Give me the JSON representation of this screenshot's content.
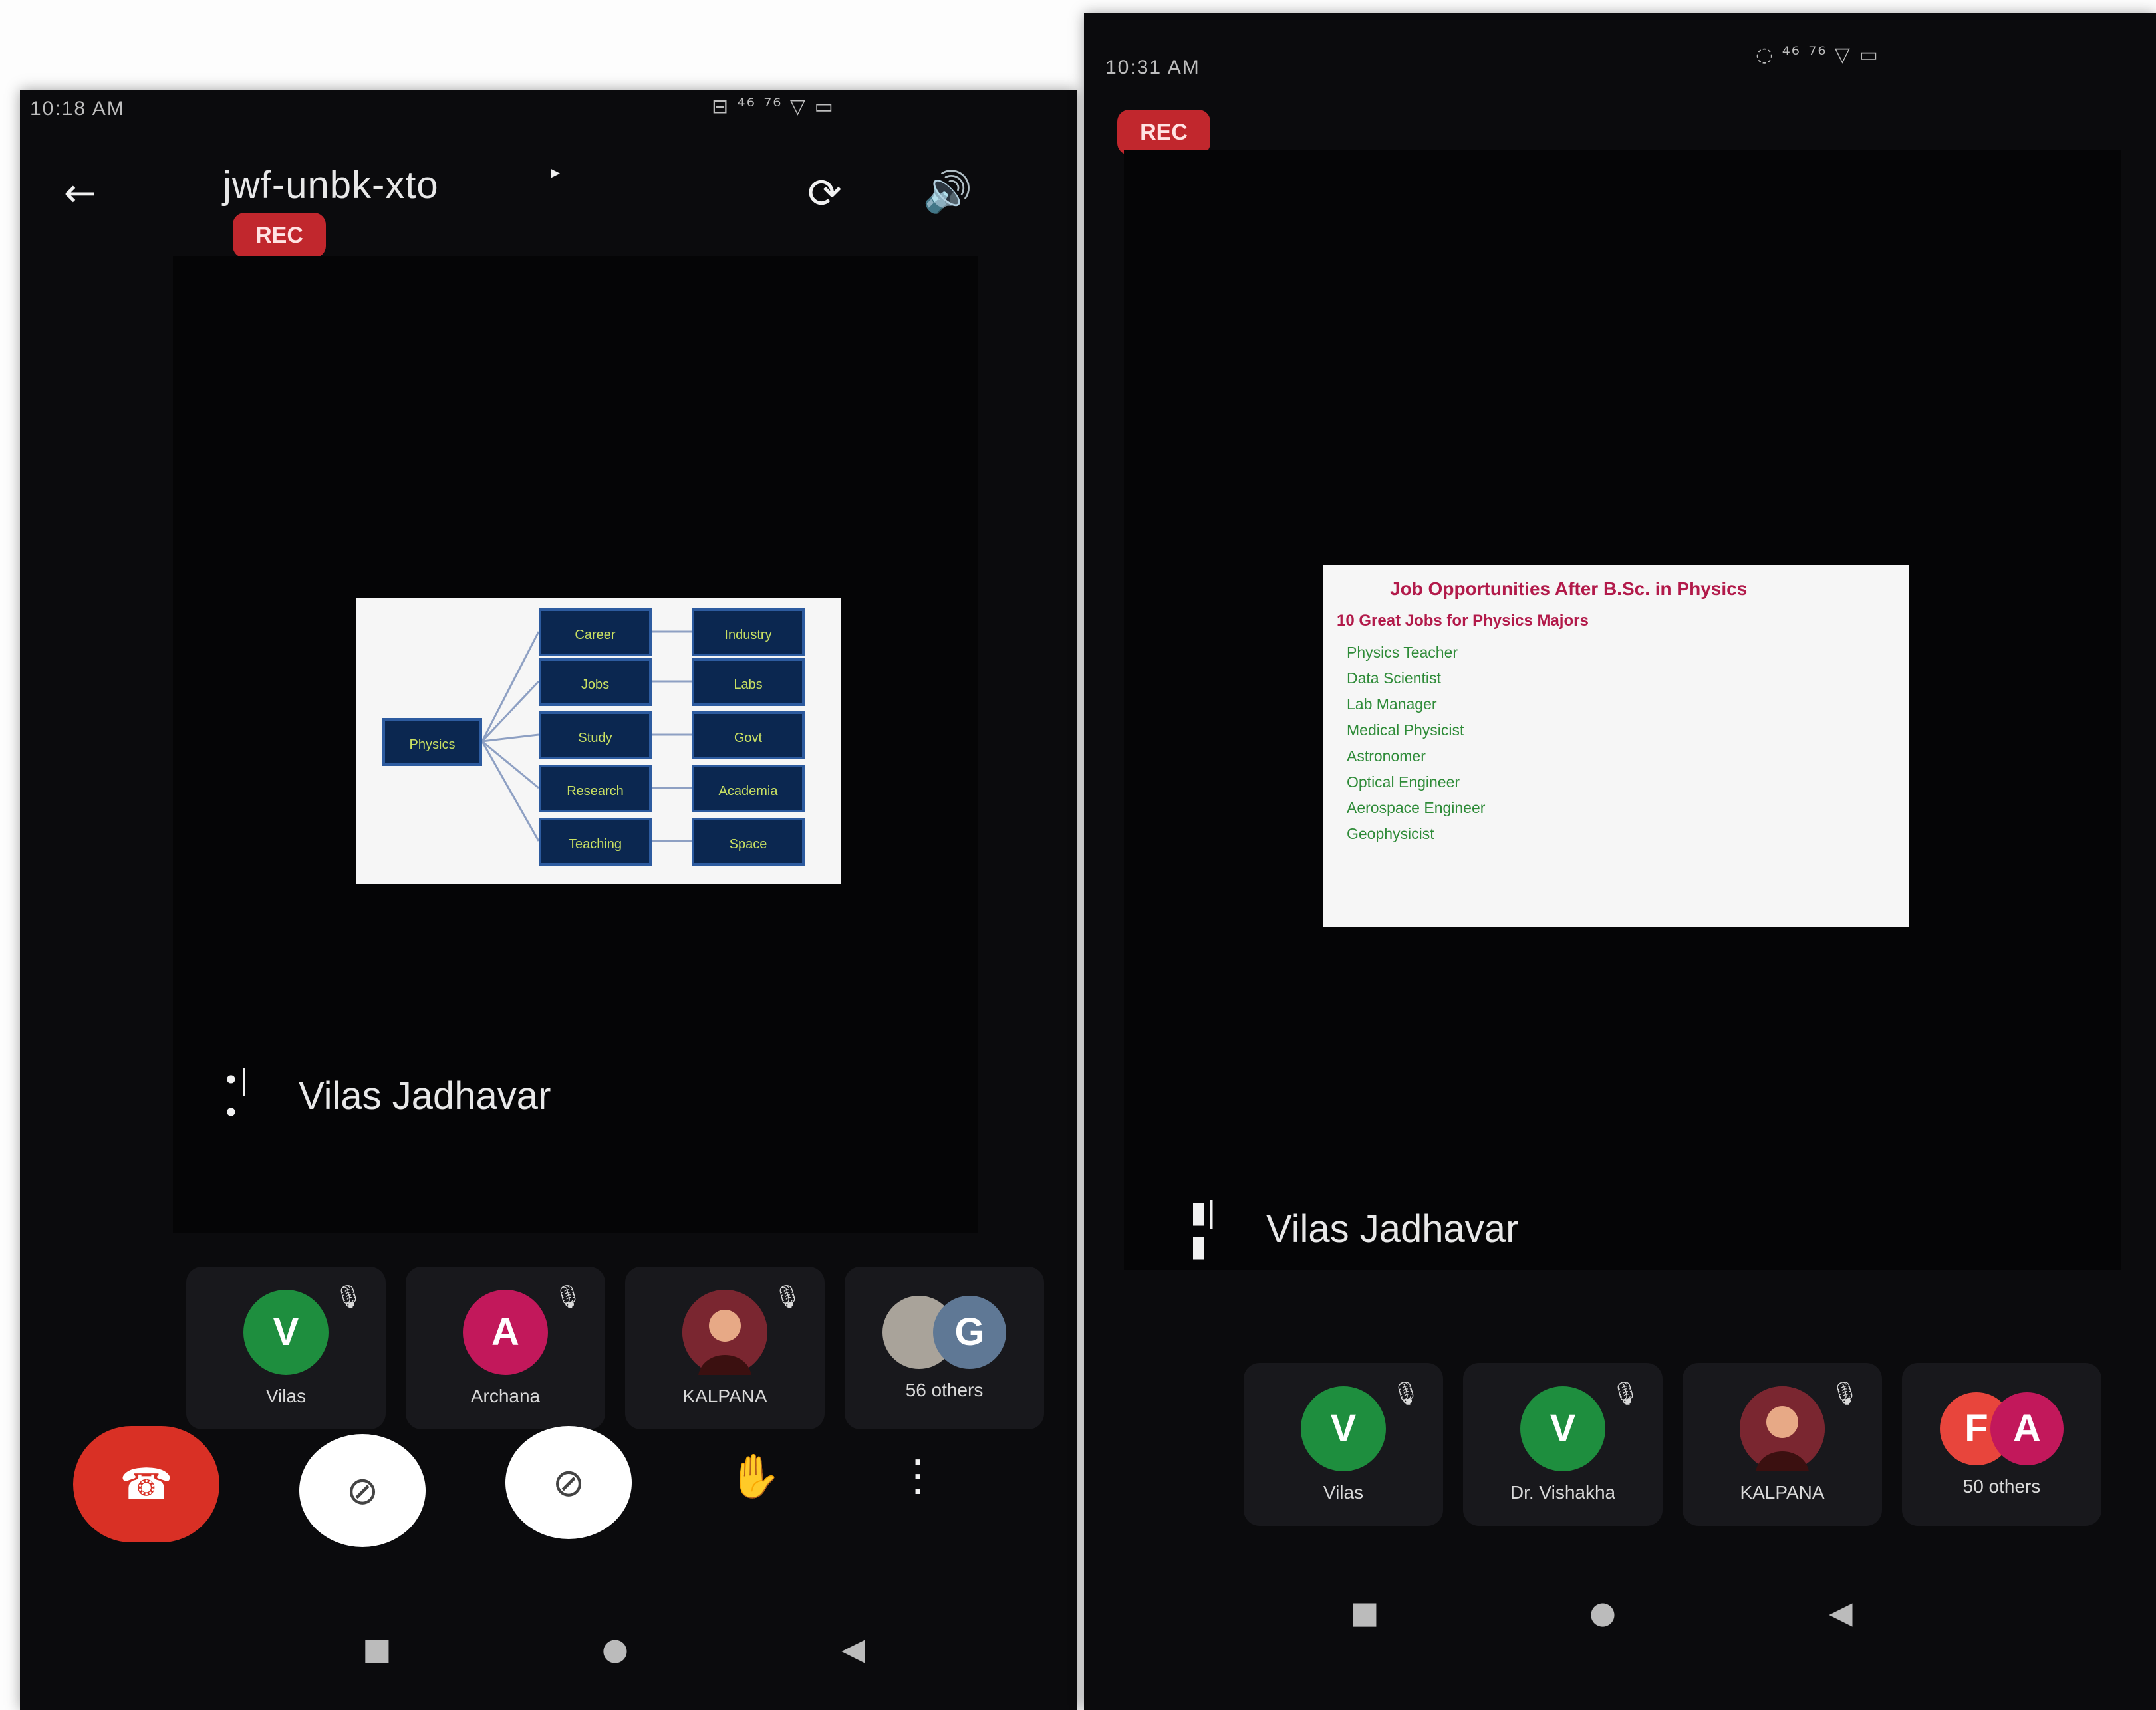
{
  "left_screen": {
    "status": {
      "time": "10:18 AM",
      "icons_text": "⊟ ⁴⁶ ⁷⁶ ▽ ▭"
    },
    "meeting": {
      "code": "jwf-unbk-xto",
      "recording_badge": "REC",
      "speaker_name": "Vilas Jadhavar"
    },
    "icons": {
      "back": "arrow-left-icon",
      "switch_camera": "switch-camera-icon",
      "speaker": "volume-icon",
      "mic_activity": "audio-wave-icon"
    },
    "participants": [
      {
        "label": "Vilas",
        "initial": "V",
        "color": "#1e8e3e",
        "muted": true
      },
      {
        "label": "Archana",
        "initial": "A",
        "color": "#c2185b",
        "muted": true
      },
      {
        "label": "KALPANA",
        "initial": "",
        "color": "#7a2630",
        "muted": true
      },
      {
        "label": "56 others",
        "initial": "G",
        "color": "#5f7895",
        "muted": false
      }
    ],
    "controls": {
      "end_call": "end-call-icon",
      "camera_off": "camera-off-icon",
      "mic_off": "mic-off-icon",
      "raise_hand": "raise-hand-icon",
      "more": "more-vert-icon"
    },
    "colors": {
      "end_call": "#d93025",
      "white_button": "#ffffff"
    }
  },
  "right_screen": {
    "status": {
      "time": "10:31 AM",
      "icons_text": "◌ ⁴⁶ ⁷⁶ ▽ ▭"
    },
    "meeting": {
      "recording_badge": "REC",
      "speaker_name": "Vilas Jadhavar"
    },
    "icons": {
      "mic_activity": "audio-bars-icon"
    },
    "slide": {
      "heading": "Job Opportunities After B.Sc. in Physics",
      "subheading": "10 Great Jobs for Physics Majors",
      "items": [
        "Physics Teacher",
        "Data Scientist",
        "Lab Manager",
        "Medical Physicist",
        "Astronomer",
        "Optical Engineer",
        "Aerospace Engineer",
        "Geophysicist"
      ]
    },
    "participants": [
      {
        "label": "Vilas",
        "initial": "V",
        "color": "#1e8e3e",
        "muted": true
      },
      {
        "label": "Dr. Vishakha",
        "initial": "V",
        "color": "#1e8e3e",
        "muted": true
      },
      {
        "label": "KALPANA",
        "initial": "",
        "color": "#7a2630",
        "muted": true
      },
      {
        "label": "50 others",
        "initial": "F",
        "secondary_initial": "A",
        "color": "#e8453c",
        "secondary_color": "#c2185b",
        "muted": false
      }
    ]
  },
  "left_diagram": {
    "root": "Physics",
    "middle": [
      "Career",
      "Jobs",
      "Study",
      "Research",
      "Teaching"
    ],
    "right": [
      "Industry",
      "Labs",
      "Govt",
      "Academia",
      "Space"
    ]
  }
}
